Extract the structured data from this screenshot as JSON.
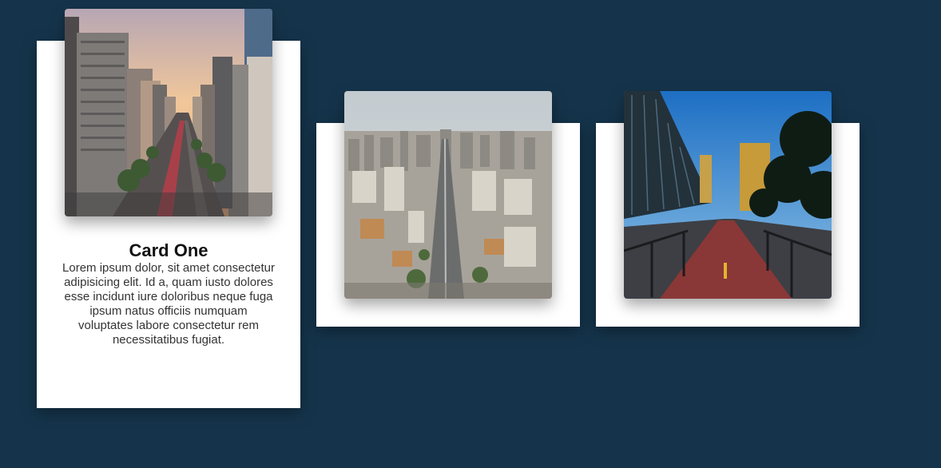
{
  "cards": [
    {
      "title": "Card One",
      "text": "Lorem ipsum dolor, sit amet consectetur adipisicing elit. Id a, quam iusto dolores esse incidunt iure doloribus neque fuga ipsum natus officiis numquam voluptates labore consectetur rem necessitatibus fugiat.",
      "image_icon": "city-avenue-sunset-photo"
    },
    {
      "image_icon": "city-aerial-highway-photo"
    },
    {
      "image_icon": "avenue-bike-lane-photo"
    }
  ],
  "colors": {
    "background": "#15344b",
    "card": "#ffffff"
  }
}
